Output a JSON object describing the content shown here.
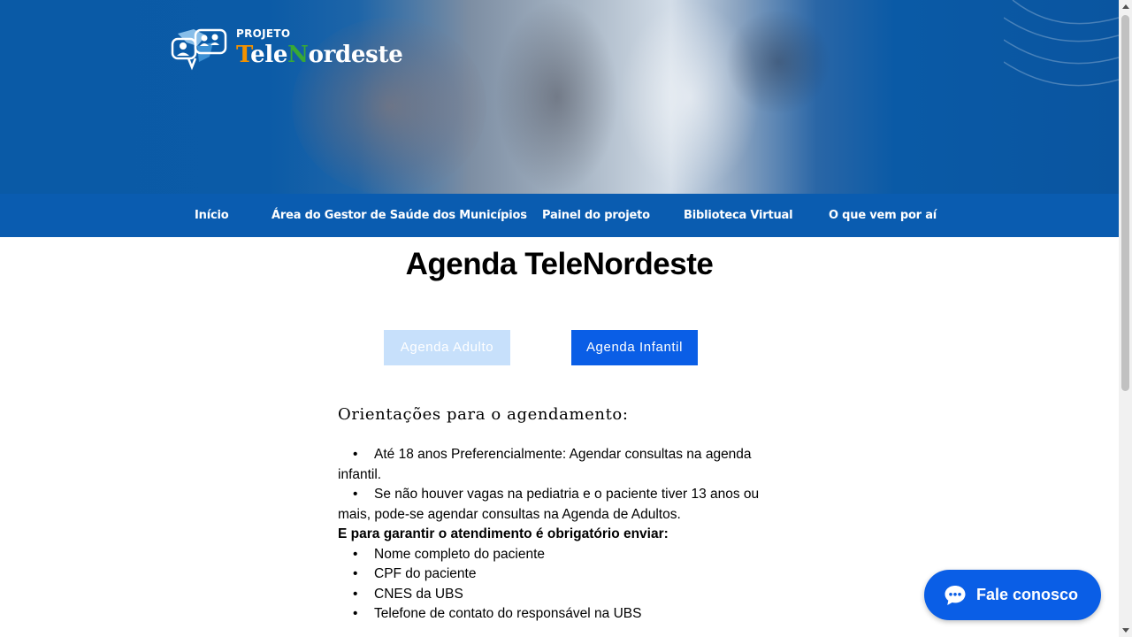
{
  "header": {
    "logo": {
      "small_text": "PROJETO",
      "big_text_t": "T",
      "big_text_ele": "ele",
      "big_text_n": "N",
      "big_text_rest": "ordeste",
      "icon": "people-chat-logo-icon"
    }
  },
  "nav": {
    "items": [
      {
        "label": "Início"
      },
      {
        "label": "Área do Gestor de Saúde dos Municípios"
      },
      {
        "label": "Painel do projeto"
      },
      {
        "label": "Biblioteca Virtual"
      },
      {
        "label": "O que vem por aí"
      }
    ]
  },
  "main": {
    "title": "Agenda TeleNordeste",
    "buttons": {
      "adult": "Agenda Adulto",
      "child": "Agenda Infantil"
    },
    "orientations": {
      "heading": "Orientações para o agendamento:",
      "bullet": "•",
      "item1": "Até 18 anos Preferencialmente: Agendar consultas na agenda",
      "item1_cont": "infantil.",
      "item2": "Se não houver vagas na pediatria e o paciente tiver 13 anos ou",
      "item2_cont": "mais, pode-se agendar consultas na Agenda de Adultos.",
      "required_heading": "E para garantir o atendimento é obrigatório enviar:",
      "required": [
        "Nome completo do paciente",
        "CPF do paciente",
        "CNES da UBS",
        "Telefone de contato do responsável na UBS"
      ]
    }
  },
  "chat": {
    "label": "Fale conosco",
    "icon": "chat-bubble-icon"
  },
  "colors": {
    "nav_bg": "#0a5cb0",
    "primary_button": "#0a5ee6",
    "disabled_button": "#c7e0fb",
    "logo_orange": "#f39200",
    "logo_green": "#39a935"
  }
}
